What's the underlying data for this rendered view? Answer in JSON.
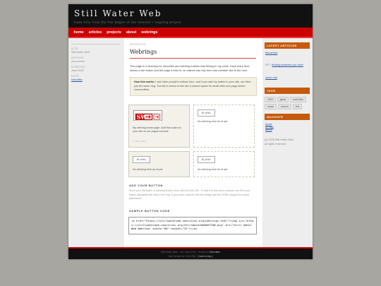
{
  "header": {
    "title": "Still Water Web",
    "tagline": "Cass Finn from the Far Edges of the Internet  /  ongoing project"
  },
  "nav": [
    "home",
    "articles",
    "projects",
    "about",
    "webrings"
  ],
  "left": {
    "site_label": "SITE",
    "site_value": "Still Water Web",
    "author_label": "AUTHOR",
    "author_value": "one person",
    "started_label": "STARTED",
    "started_value": "June 2020",
    "host_label": "HOST",
    "host_value": "Neocities"
  },
  "main": {
    "breadcrumb": "WEBRING",
    "title": "Webrings",
    "intro": "This page is a directory for Neocities and webring buttons that belong in my circle. Each entry here shows a site button and the page it links to, so visitors can hop from one member site to the next.",
    "notice_bold": "How this works:",
    "notice_text": " I add other people's buttons here, and if you add my button to your site, our sites join the same ring. The list is meant to feel like a shared space for small sites and page-button communities.",
    "cards": [
      {
        "badge": "STILL WATER",
        "text": "My webring home page. Add this button to your site on our pages connect.",
        "link": "[ copy code ]"
      },
      {
        "badge": "BLANK",
        "text": "No webring here as of yet."
      },
      {
        "badge": "BLANK",
        "text": "No webring here as of yet."
      },
      {
        "badge": "BLANK",
        "text": "No webring here as of yet."
      }
    ],
    "add_title": "ADD YOUR BUTTON",
    "add_text": "Send your Neocities or webring button from with the link URL. I'll add it to this list so visitors can find your button alongside the rest of the ring. If you want, include both the image and the HTML snippet for easier placement.",
    "sample_title": "SAMPLE BUTTON CODE",
    "code": "<a href=\"https://stillwaterweb.neocities.org/webrings.html\"><img src=\"https://stillwaterweb.neocities.org/StillWaterWebBUTTON.png\" alt=\"Still Water Web Webring\" width=\"88\" height=\"31\"></a>"
  },
  "right": {
    "latest_title": "LATEST ARTICLES",
    "latest": [
      {
        "text": "test article",
        "link": true
      },
      {
        "prefix": "007 / ",
        "text": "finding someone you have never met",
        "link": true
      }
    ],
    "tags_title": "TAGS",
    "tags": [
      "2003",
      "japan",
      "build files",
      "music",
      "search",
      "text"
    ],
    "navigate_title": "NAVIGATE",
    "navigate": [
      "home",
      "all tags",
      "about"
    ],
    "copyright": "(c) 2020 Still Water Web",
    "rights": "all rights reserved"
  },
  "footer": {
    "line1_a": "Still Water Web",
    "line1_b": " · est. June 2020 · hosted on ",
    "line1_c": "Neocities",
    "line2_a": "best viewed at 1024x768 · ",
    "line2_b": "[ back to top ]"
  },
  "colors": {
    "accent_red": "#cc0000",
    "accent_orange": "#c55a0c",
    "link_blue": "#2b55a5"
  }
}
